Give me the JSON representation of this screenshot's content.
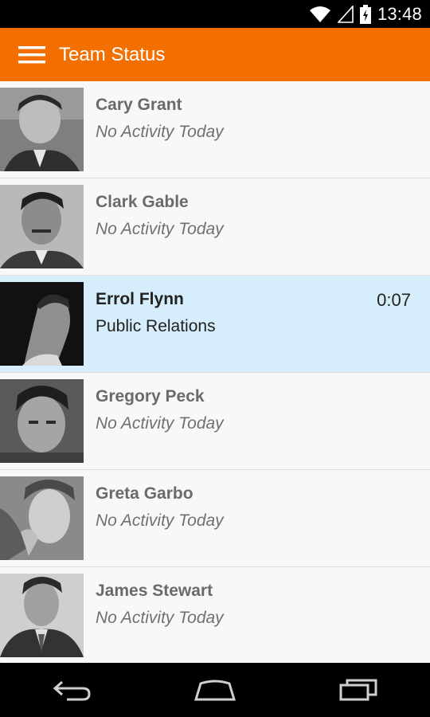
{
  "status_bar": {
    "time": "13:48",
    "icons": [
      "wifi-icon",
      "cell-signal-icon",
      "battery-charging-icon"
    ]
  },
  "app_bar": {
    "menu_icon": "hamburger-menu-icon",
    "title": "Team Status",
    "background": "#f26f00"
  },
  "team": [
    {
      "name": "Cary Grant",
      "status": "No Activity Today",
      "timer": "",
      "active": false
    },
    {
      "name": "Clark Gable",
      "status": "No Activity Today",
      "timer": "",
      "active": false
    },
    {
      "name": "Errol Flynn",
      "status": "Public Relations",
      "timer": "0:07",
      "active": true
    },
    {
      "name": "Gregory Peck",
      "status": "No Activity Today",
      "timer": "",
      "active": false
    },
    {
      "name": "Greta Garbo",
      "status": "No Activity Today",
      "timer": "",
      "active": false
    },
    {
      "name": "James Stewart",
      "status": "No Activity Today",
      "timer": "",
      "active": false
    }
  ],
  "colors": {
    "active_row": "#d6eefb",
    "row": "#f8f8f8"
  },
  "nav_bar": {
    "icons": [
      "back-icon",
      "home-icon",
      "recents-icon"
    ]
  }
}
